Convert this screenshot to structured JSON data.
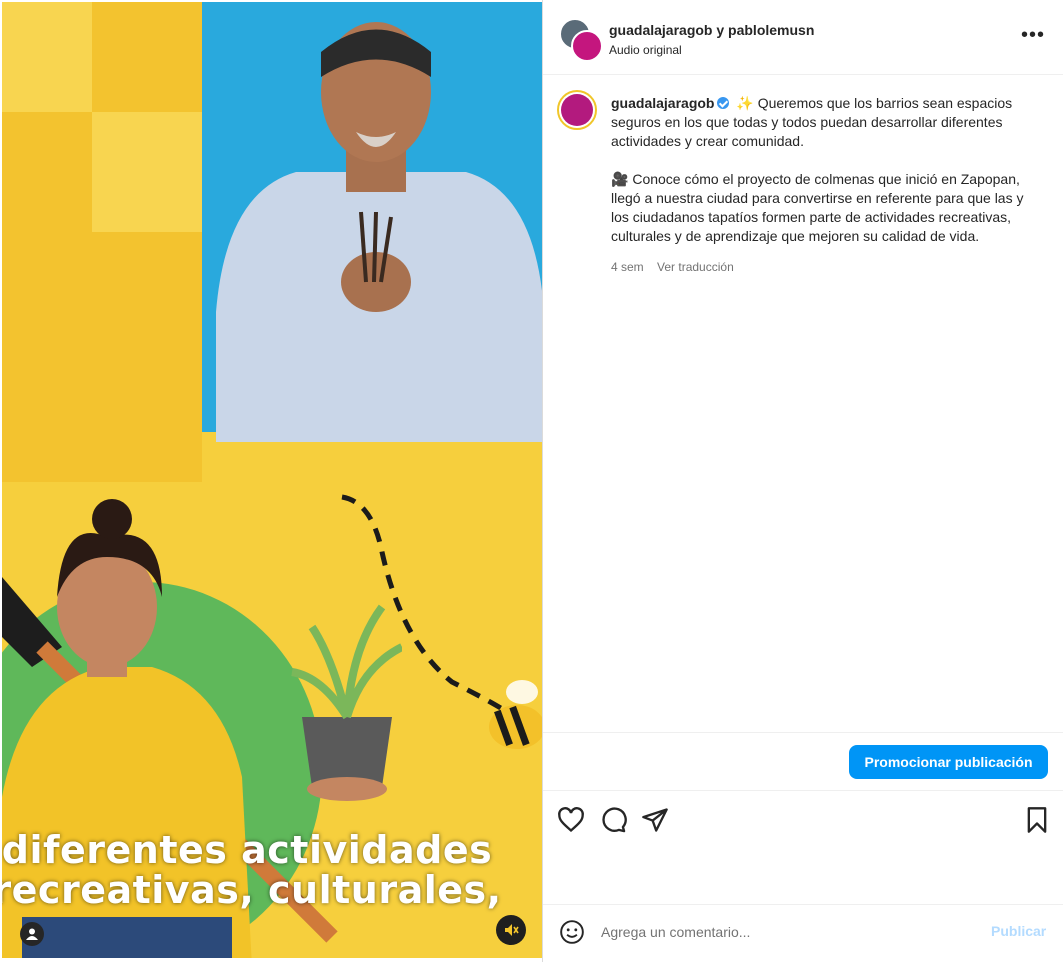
{
  "media": {
    "caption_line1": "diferentes actividades",
    "caption_line2": "recreativas, culturales,"
  },
  "header": {
    "names": "guadalajaragob y pablolemusn",
    "audio": "Audio original",
    "more_label": "•••"
  },
  "post": {
    "username": "guadalajaragob",
    "sparkle": "✨",
    "line1": "Queremos que los barrios sean espacios seguros en los que todas y todos puedan desarrollar diferentes actividades y crear comunidad.",
    "camera": "🎥",
    "line2": "Conoce cómo el proyecto de colmenas que inició en Zapopan, llegó a nuestra ciudad para convertirse en referente para que las y los ciudadanos tapatíos formen parte de actividades recreativas, culturales y de aprendizaje que mejoren su calidad de vida.",
    "time": "4 sem",
    "translate": "Ver traducción"
  },
  "promote_label": "Promocionar publicación",
  "comment": {
    "placeholder": "Agrega un comentario...",
    "publish_label": "Publicar"
  },
  "colors": {
    "accent": "#0095f6",
    "yellow": "#f6cf3d",
    "blue": "#29a9dd",
    "green": "#5fb85a"
  }
}
